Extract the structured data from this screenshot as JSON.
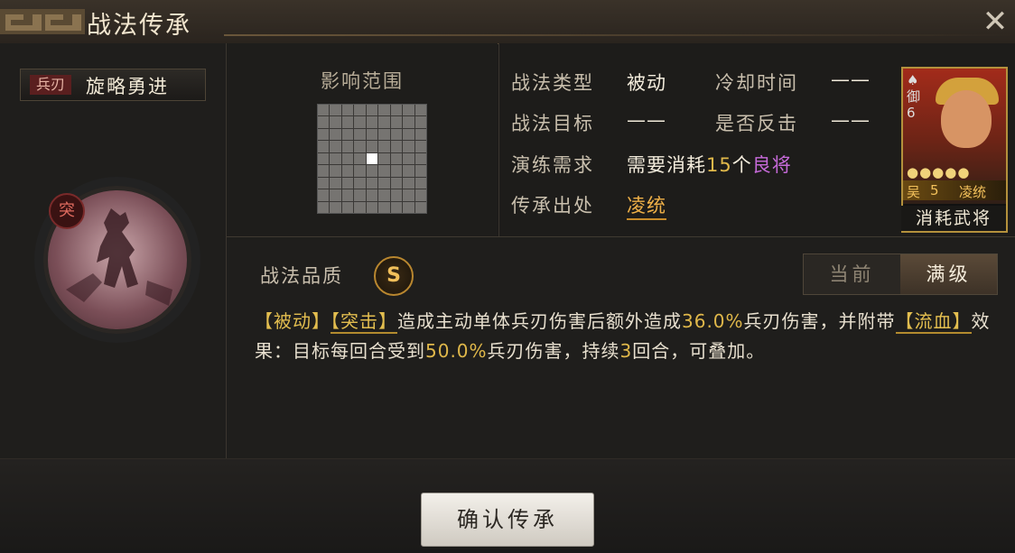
{
  "window": {
    "title": "战法传承",
    "close_glyph": "✕"
  },
  "skill": {
    "type_tag": "兵刃",
    "name": "旋略勇进",
    "badge": "突"
  },
  "range": {
    "title": "影响范围"
  },
  "info": {
    "type_label": "战法类型",
    "type_value": "被动",
    "cooldown_label": "冷却时间",
    "cooldown_value": "——",
    "target_label": "战法目标",
    "target_value": "——",
    "counter_label": "是否反击",
    "counter_value": "——",
    "req_label": "演练需求",
    "req_prefix": "需要消耗",
    "req_count": "15",
    "req_unit": "个",
    "req_quality": "良将",
    "source_label": "传承出处",
    "source_value": "凌统"
  },
  "hero_card": {
    "side_top": "御",
    "side_num": "6",
    "stars": "●●●●●",
    "faction": "吴",
    "level": "5",
    "name": "凌统",
    "consume_label": "消耗武将"
  },
  "quality": {
    "label": "战法品质",
    "grade": "S"
  },
  "tabs": {
    "current": "当前",
    "max": "满级"
  },
  "description": {
    "tag_passive": "【被动】",
    "tag_assault": "【突击】",
    "text1": "造成主动单体兵刃伤害后额外造成",
    "pct1": "36.0%",
    "text2": "兵刃伤害，并附带",
    "tag_bleed": "【流血】",
    "text3": "效果：目标每回合受到",
    "pct2": "50.0%",
    "text4": "兵刃伤害，持续",
    "turns": "3",
    "text5": "回合，可叠加。"
  },
  "footer": {
    "confirm_label": "确认传承"
  },
  "colors": {
    "accent_gold": "#e0b84a",
    "quality_purple": "#c66ad9",
    "link_orange": "#f0b148"
  }
}
